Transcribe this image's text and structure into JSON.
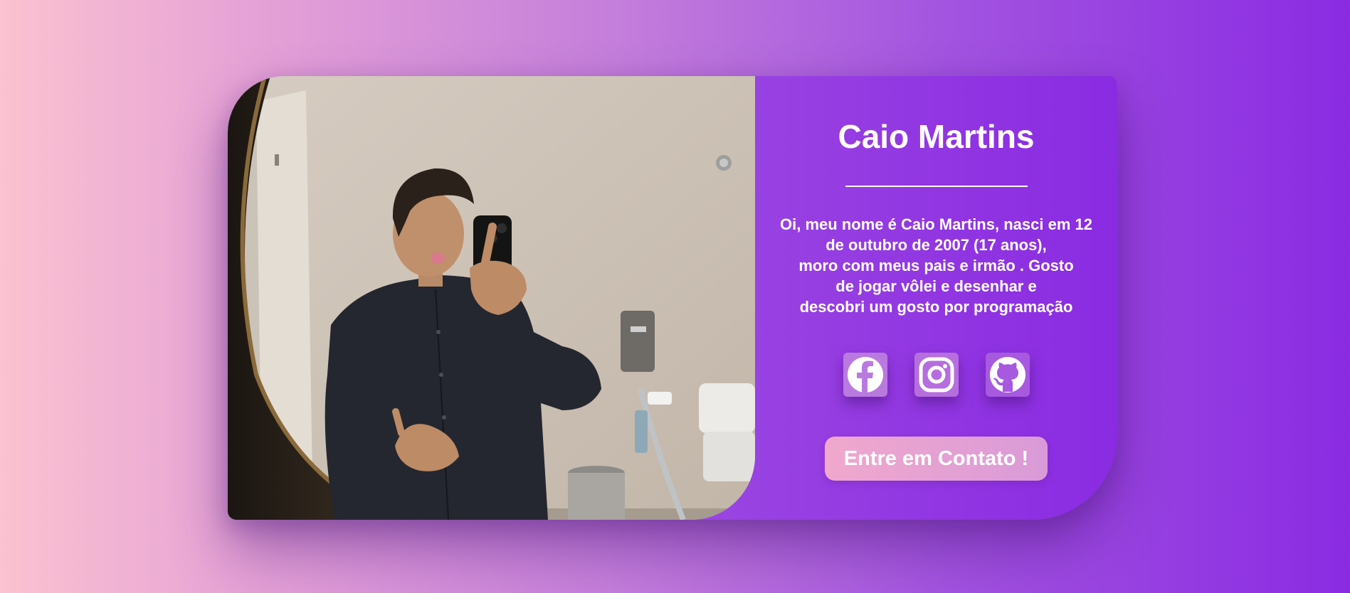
{
  "profile": {
    "name": "Caio Martins",
    "bio_lines": [
      "Oi, meu nome é Caio Martins, nasci em 12",
      "de outubro de 2007 (17 anos),",
      "moro com meus pais e irmão . Gosto",
      "de jogar vôlei e desenhar e",
      "descobri um gosto por programação"
    ]
  },
  "socials": [
    {
      "icon": "facebook-icon"
    },
    {
      "icon": "instagram-icon"
    },
    {
      "icon": "github-icon"
    }
  ],
  "cta": {
    "label": "Entre em Contato !"
  },
  "colors": {
    "gradient_start": "#fbc2d0",
    "gradient_end": "#8a2be2",
    "text": "#ffffff"
  }
}
